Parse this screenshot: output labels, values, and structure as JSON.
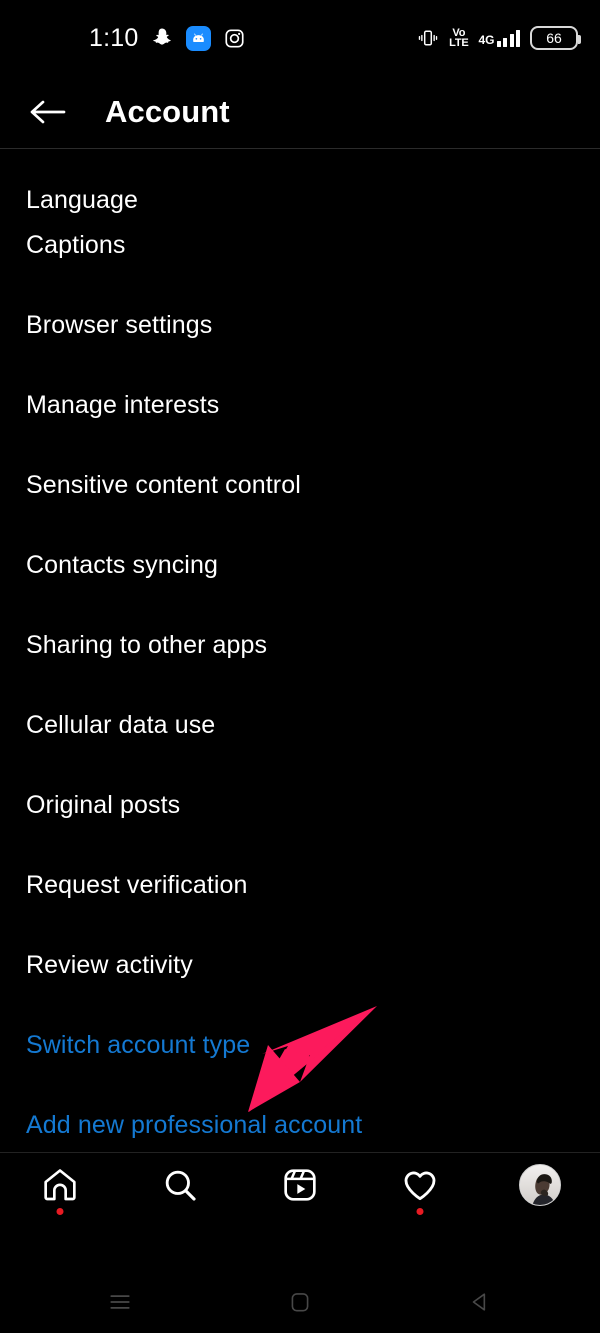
{
  "status_bar": {
    "time": "1:10",
    "left_icons": [
      "snapchat-icon",
      "android-bot-icon",
      "instagram-icon"
    ],
    "volte_top": "Vo",
    "volte_bottom": "LTE",
    "network": "4G",
    "signal_bars": 4,
    "battery_level": "66",
    "vibrate_icon": "vibrate-icon"
  },
  "header": {
    "back_icon": "back-arrow-icon",
    "title": "Account"
  },
  "list": {
    "items": [
      {
        "label": "Language",
        "type": "normal",
        "clipped": true
      },
      {
        "label": "Captions",
        "type": "normal"
      },
      {
        "label": "Browser settings",
        "type": "normal"
      },
      {
        "label": "Manage interests",
        "type": "normal"
      },
      {
        "label": "Sensitive content control",
        "type": "normal"
      },
      {
        "label": "Contacts syncing",
        "type": "normal"
      },
      {
        "label": "Sharing to other apps",
        "type": "normal"
      },
      {
        "label": "Cellular data use",
        "type": "normal"
      },
      {
        "label": "Original posts",
        "type": "normal"
      },
      {
        "label": "Request verification",
        "type": "normal"
      },
      {
        "label": "Review activity",
        "type": "normal"
      },
      {
        "label": "Switch account type",
        "type": "link"
      },
      {
        "label": "Add new professional account",
        "type": "link"
      }
    ]
  },
  "annotation": {
    "arrow_color": "#FC1A5C",
    "points_to": "Add new professional account"
  },
  "bottom_nav": {
    "items": [
      {
        "name": "home-icon",
        "badge": true
      },
      {
        "name": "search-icon",
        "badge": false
      },
      {
        "name": "reels-icon",
        "badge": false
      },
      {
        "name": "heart-icon",
        "badge": true
      },
      {
        "name": "profile-avatar",
        "badge": false
      }
    ]
  },
  "android_nav": {
    "items": [
      "recents-icon",
      "home-square-icon",
      "back-triangle-icon"
    ]
  },
  "colors": {
    "background": "#000000",
    "text": "#ffffff",
    "link": "#1479d2",
    "badge": "#e81b23",
    "arrow": "#FC1A5C",
    "blue_badge": "#1a8cff"
  }
}
